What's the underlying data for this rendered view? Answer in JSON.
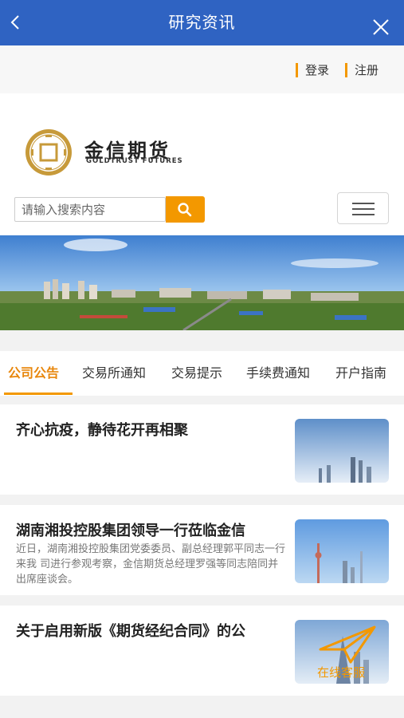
{
  "header": {
    "title": "研究资讯"
  },
  "auth": {
    "login": "登录",
    "register": "注册"
  },
  "brand": {
    "name": "金信期货",
    "name_en": "GOLDTRUST FUTURES"
  },
  "search": {
    "placeholder": "请输入搜索内容"
  },
  "tabs": [
    {
      "label": "公司公告",
      "active": true
    },
    {
      "label": "交易所通知",
      "active": false
    },
    {
      "label": "交易提示",
      "active": false
    },
    {
      "label": "手续费通知",
      "active": false
    },
    {
      "label": "开户指南",
      "active": false
    }
  ],
  "news": [
    {
      "title": "齐心抗疫，静待花开再相聚",
      "summary": ""
    },
    {
      "title": "湖南湘投控股集团领导一行莅临金信",
      "summary": "近日，湖南湘投控股集团党委委员、副总经理郭平同志一行来我 司进行参观考察，金信期货总经理罗强等同志陪同并出席座谈会。"
    },
    {
      "title": "关于启用新版《期货经纪合同》的公",
      "summary": ""
    }
  ],
  "floating": {
    "service_label": "在线客服"
  },
  "colors": {
    "header_blue": "#2f63c2",
    "accent_orange": "#f39800"
  }
}
